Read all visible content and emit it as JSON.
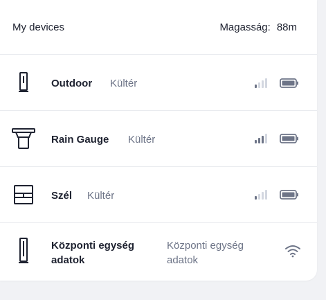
{
  "header": {
    "title": "My devices",
    "altitude_label": "Magasság:",
    "altitude_value": "88m"
  },
  "devices": [
    {
      "name": "Outdoor",
      "location": "Kültér",
      "icon": "outdoor-sensor-icon",
      "signal_bars": 1,
      "battery": 1.0
    },
    {
      "name": "Rain Gauge",
      "location": "Kültér",
      "icon": "rain-gauge-icon",
      "signal_bars": 3,
      "battery": 1.0
    },
    {
      "name": "Szél",
      "location": "Kültér",
      "icon": "wind-sensor-icon",
      "signal_bars": 1,
      "battery": 1.0
    },
    {
      "name_line1": "Központi egység",
      "name_line2": "adatok",
      "location_line1": "Központi egység",
      "location_line2": "adatok",
      "icon": "base-station-icon",
      "connection": "wifi-icon"
    }
  ],
  "colors": {
    "text": "#1e2230",
    "muted": "#6d7487",
    "signal_active": "#6d7487",
    "signal_inactive": "#d3d7e0",
    "divider": "#e9ebef"
  }
}
